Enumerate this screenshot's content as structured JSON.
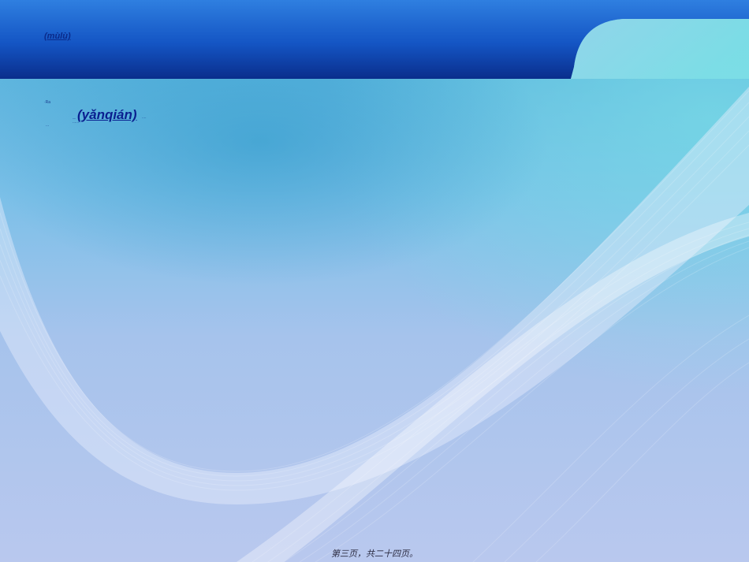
{
  "slide": {
    "title": "(mùlù)",
    "items": {
      "note_a": "·Ra",
      "note_b": "...",
      "link_text": "(yǎnqián)",
      "link_prefix": "..",
      "note_c": "......",
      "note_d": "...."
    },
    "footer": "第三页，共二十四页。"
  },
  "colors": {
    "header_dark": "#0a2e8c",
    "header_light": "#2f7fe0",
    "accent_teal": "#7ee0e6",
    "link": "#0a1f8f"
  }
}
